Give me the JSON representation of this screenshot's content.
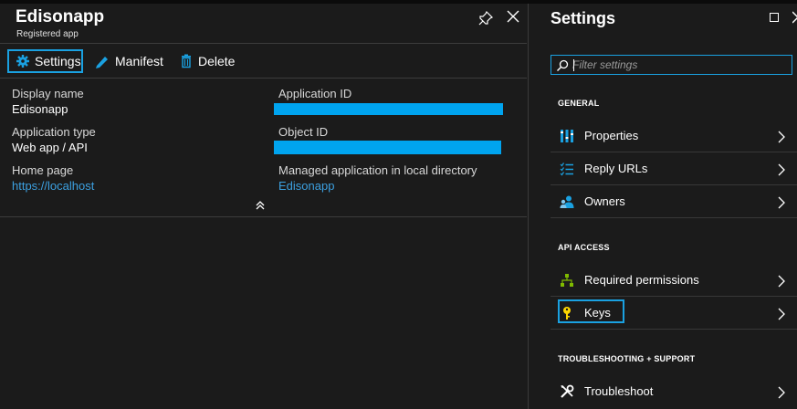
{
  "left_blade": {
    "title": "Edisonapp",
    "subtitle": "Registered app",
    "commands": {
      "settings": "Settings",
      "manifest": "Manifest",
      "delete": "Delete"
    },
    "essentials": {
      "display_name_label": "Display name",
      "display_name_value": "Edisonapp",
      "app_type_label": "Application type",
      "app_type_value": "Web app / API",
      "home_page_label": "Home page",
      "home_page_value": "https://localhost",
      "app_id_label": "Application ID",
      "object_id_label": "Object ID",
      "managed_app_label": "Managed application in local directory",
      "managed_app_value": "Edisonapp"
    }
  },
  "settings_blade": {
    "title": "Settings",
    "filter_placeholder": "Filter settings",
    "sections": {
      "general": "GENERAL",
      "api_access": "API ACCESS",
      "troubleshooting": "TROUBLESHOOTING + SUPPORT"
    },
    "items": {
      "properties": "Properties",
      "reply_urls": "Reply URLs",
      "owners": "Owners",
      "required_permissions": "Required permissions",
      "keys": "Keys",
      "troubleshoot": "Troubleshoot"
    }
  },
  "colors": {
    "background": "#1b1b1b",
    "accent": "#1aa1e1",
    "link": "#3ca0e0",
    "redaction": "#00a4ef"
  }
}
